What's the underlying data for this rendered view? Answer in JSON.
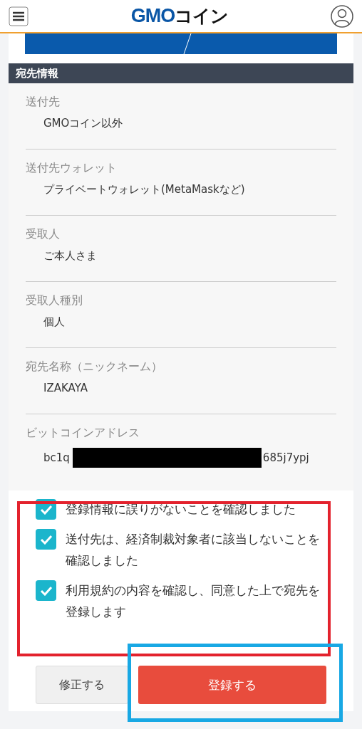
{
  "header": {
    "logo_latin": "GMO",
    "logo_kana": "コイン"
  },
  "section": {
    "title": "宛先情報"
  },
  "fields": [
    {
      "label": "送付先",
      "value": "GMOコイン以外"
    },
    {
      "label": "送付先ウォレット",
      "value": "プライベートウォレット(MetaMaskなど)"
    },
    {
      "label": "受取人",
      "value": "ご本人さま"
    },
    {
      "label": "受取人種別",
      "value": "個人"
    },
    {
      "label": "宛先名称（ニックネーム）",
      "value": "IZAKAYA"
    },
    {
      "label": "ビットコインアドレス",
      "value": "bc1q",
      "value_end": "685j7ypj",
      "redacted": true
    }
  ],
  "confirmations": [
    {
      "label": "登録情報に誤りがないことを確認しました",
      "checked": true
    },
    {
      "label": "送付先は、経済制裁対象者に該当しないことを確認しました",
      "checked": true
    },
    {
      "label": "利用規約の内容を確認し、同意した上で宛先を登録します",
      "checked": true
    }
  ],
  "buttons": [
    {
      "label": "修正する",
      "kind": "secondary"
    },
    {
      "label": "登録する",
      "kind": "primary"
    }
  ]
}
